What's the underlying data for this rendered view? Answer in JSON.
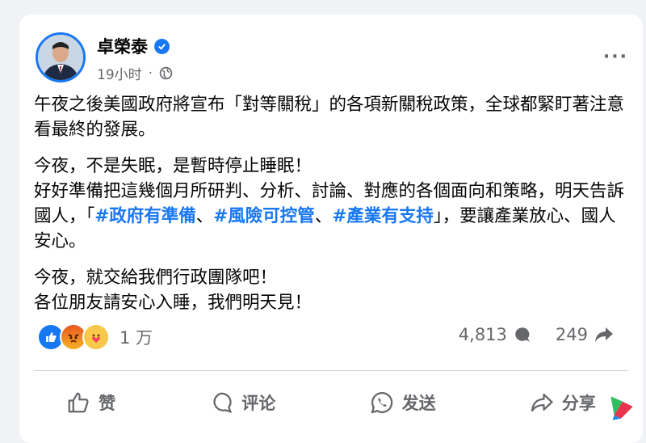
{
  "post": {
    "author": "卓榮泰",
    "time": "19小时",
    "paragraphs": {
      "p1": "午夜之後美國政府將宣布「對等關稅」的各項新關稅政策，全球都緊盯著注意看最終的發展。",
      "p2_line1": "今夜，不是失眠，是暫時停止睡眠！",
      "p2_line2a": "好好準備把這幾個月所研判、分析、討論、對應的各個面向和策略，明天告訴國人，「",
      "tag1": "#政府有準備",
      "sep1": "、",
      "tag2": "#風險可控管",
      "sep2": "、",
      "tag3": "#產業有支持",
      "p2_line2b": "」，要讓產業放心、國人安心。",
      "p3_line1": "今夜，就交給我們行政團隊吧！",
      "p3_line2": "各位朋友請安心入睡，我們明天見！"
    }
  },
  "stats": {
    "reactions": "1 万",
    "comments": "4,813",
    "shares": "249"
  },
  "actions": {
    "like": "赞",
    "comment": "评论",
    "send": "发送",
    "share": "分享"
  },
  "icons": {
    "verified": "verified-badge-icon",
    "globe": "globe-icon",
    "more": "more-icon"
  },
  "colors": {
    "accent": "#1877f2",
    "secondary_text": "#65676b"
  }
}
